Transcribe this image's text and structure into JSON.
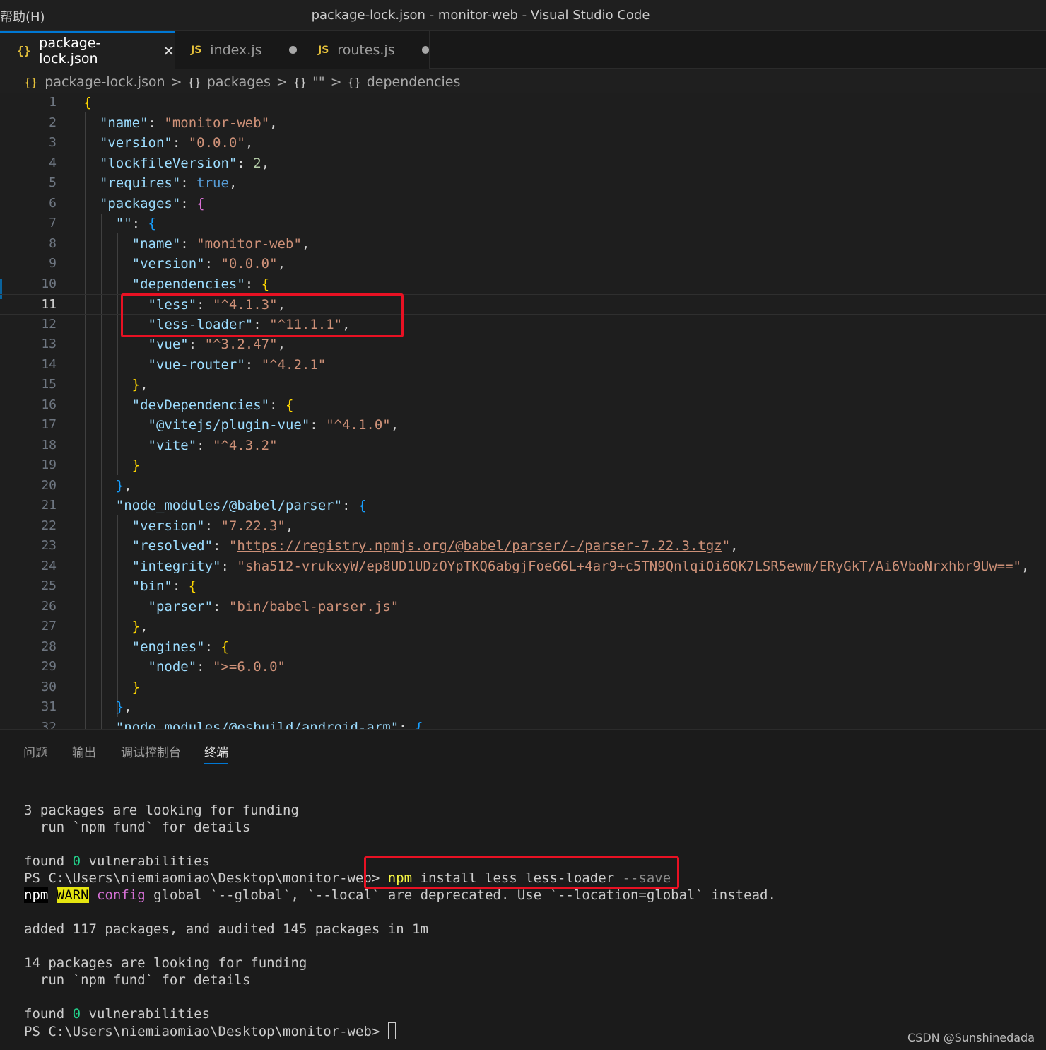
{
  "titlebar": {
    "menu_help": "帮助(H)",
    "title": "package-lock.json - monitor-web - Visual Studio Code"
  },
  "tabs": [
    {
      "icon": "{}",
      "label": "package-lock.json",
      "close": "✕",
      "active": true
    },
    {
      "icon": "JS",
      "label": "index.js",
      "modified": true
    },
    {
      "icon": "JS",
      "label": "routes.js",
      "modified": true
    }
  ],
  "breadcrumb": {
    "file_icon": "{}",
    "file": "package-lock.json",
    "obj_icon": "{}",
    "seg1": "packages",
    "seg2": "\"\"",
    "seg3": "dependencies",
    "sep": ">"
  },
  "editor": {
    "line_numbers": [
      "1",
      "2",
      "3",
      "4",
      "5",
      "6",
      "7",
      "8",
      "9",
      "10",
      "11",
      "12",
      "13",
      "14",
      "15",
      "16",
      "17",
      "18",
      "19",
      "20",
      "21",
      "22",
      "23",
      "24",
      "25",
      "26",
      "27",
      "28",
      "29",
      "30",
      "31",
      "32"
    ],
    "current_line": "11",
    "tokens": {
      "l2k": "\"name\"",
      "l2v": "\"monitor-web\"",
      "l3k": "\"version\"",
      "l3v": "\"0.0.0\"",
      "l4k": "\"lockfileVersion\"",
      "l4v": "2",
      "l5k": "\"requires\"",
      "l5v": "true",
      "l6k": "\"packages\"",
      "l7k": "\"\"",
      "l8k": "\"name\"",
      "l8v": "\"monitor-web\"",
      "l9k": "\"version\"",
      "l9v": "\"0.0.0\"",
      "l10k": "\"dependencies\"",
      "l11k": "\"less\"",
      "l11v": "\"^4.1.3\"",
      "l12k": "\"less-loader\"",
      "l12v": "\"^11.1.1\"",
      "l13k": "\"vue\"",
      "l13v": "\"^3.2.47\"",
      "l14k": "\"vue-router\"",
      "l14v": "\"^4.2.1\"",
      "l16k": "\"devDependencies\"",
      "l17k": "\"@vitejs/plugin-vue\"",
      "l17v": "\"^4.1.0\"",
      "l18k": "\"vite\"",
      "l18v": "\"^4.3.2\"",
      "l21k": "\"node_modules/@babel/parser\"",
      "l22k": "\"version\"",
      "l22v": "\"7.22.3\"",
      "l23k": "\"resolved\"",
      "l23q1": "\"",
      "l23v": "https://registry.npmjs.org/@babel/parser/-/parser-7.22.3.tgz",
      "l23q2": "\"",
      "l24k": "\"integrity\"",
      "l24v": "\"sha512-vrukxyW/ep8UD1UDzOYpTKQ6abgjFoeG6L+4ar9+c5TN9QnlqiOi6QK7LSR5ewm/ERyGkT/Ai6VboNrxhbr9Uw==\"",
      "l25k": "\"bin\"",
      "l26k": "\"parser\"",
      "l26v": "\"bin/babel-parser.js\"",
      "l28k": "\"engines\"",
      "l29k": "\"node\"",
      "l29v": "\">=6.0.0\"",
      "l32k": "\"node_modules/@esbuild/android-arm\""
    }
  },
  "panel": {
    "tabs": [
      "问题",
      "输出",
      "调试控制台",
      "终端"
    ],
    "active_tab": "终端",
    "terminal": {
      "t1": "3 packages are looking for funding",
      "t2": "  run `npm fund` for details",
      "t3a": "found ",
      "t3b": "0",
      "t3c": " vulnerabilities",
      "t4prompt": "PS C:\\Users\\niemiaomiao\\Desktop\\monitor-web> ",
      "t4npm": "npm",
      "t4cmd": " install less less-loader ",
      "t4flag": "--save",
      "t5npm": "npm",
      "t5warn": "WARN",
      "t5config": "config",
      "t5rest": " global `--global`, `--local` are deprecated. Use `--location=global` instead.",
      "t6": "added 117 packages, and audited 145 packages in 1m",
      "t7": "14 packages are looking for funding",
      "t8": "  run `npm fund` for details",
      "t9a": "found ",
      "t9b": "0",
      "t9c": " vulnerabilities",
      "t10prompt": "PS C:\\Users\\niemiaomiao\\Desktop\\monitor-web> "
    }
  },
  "watermark": "CSDN @Sunshinedada",
  "colors": {
    "accent": "#0078d4",
    "highlight_box": "#e81123"
  }
}
